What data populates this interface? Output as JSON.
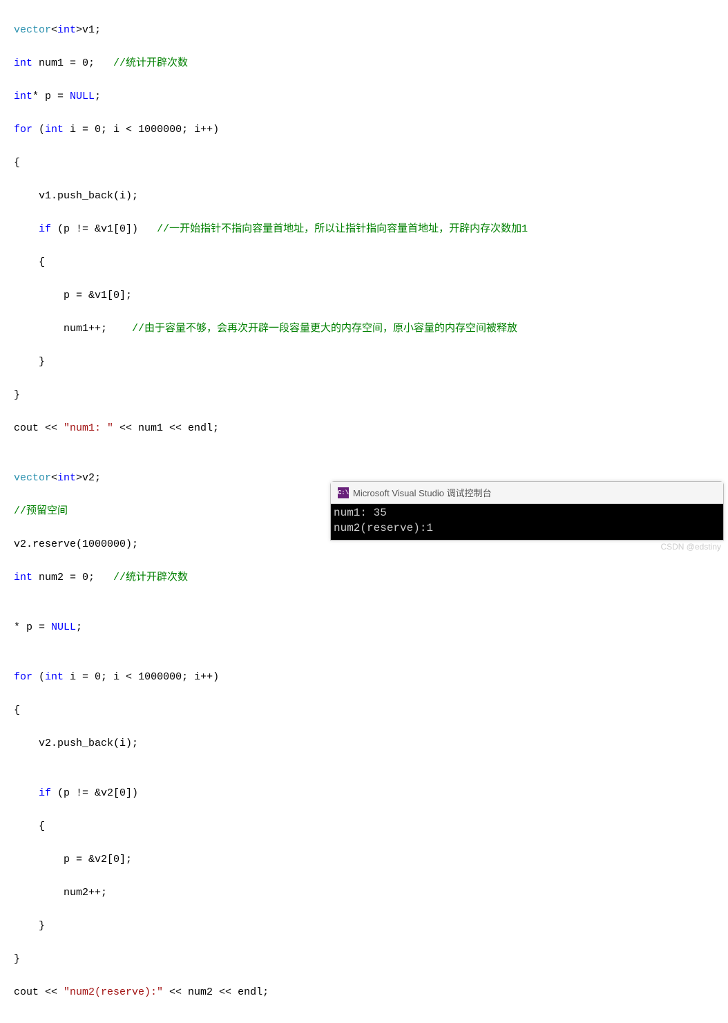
{
  "code": {
    "l1a": "vector",
    "l1b": "<",
    "l1c": "int",
    "l1d": ">v1;",
    "l2a": "int",
    "l2b": " num1 = 0;   ",
    "l2c": "//统计开辟次数",
    "l3a": "int",
    "l3b": "* p = ",
    "l3c": "NULL",
    "l3d": ";",
    "l4a": "for",
    "l4b": " (",
    "l4c": "int",
    "l4d": " i = 0; i < 1000000; i++)",
    "l5": "{",
    "l6": "    v1.push_back(i);",
    "l7a": "    ",
    "l7b": "if",
    "l7c": " (p != &v1[0])   ",
    "l7d": "//一开始指针不指向容量首地址，所以让指针指向容量首地址，开辟内存次数加1",
    "l8": "    {",
    "l9": "        p = &v1[0];",
    "l10a": "        num1++;    ",
    "l10b": "//由于容量不够，会再次开辟一段容量更大的内存空间，原小容量的内存空间被释放",
    "l11": "    }",
    "l12": "}",
    "l13a": "cout << ",
    "l13b": "\"num1: \"",
    "l13c": " << num1 << endl;",
    "l14": "",
    "l15a": "vector",
    "l15b": "<",
    "l15c": "int",
    "l15d": ">v2;",
    "l16": "//预留空间",
    "l17": "v2.reserve(1000000);",
    "l18a": "int",
    "l18b": " num2 = 0;   ",
    "l18c": "//统计开辟次数",
    "l19": "",
    "l20a": "* p = ",
    "l20b": "NULL",
    "l20c": ";",
    "l21": "",
    "l22a": "for",
    "l22b": " (",
    "l22c": "int",
    "l22d": " i = 0; i < 1000000; i++)",
    "l23": "{",
    "l24": "    v2.push_back(i);",
    "l25": "",
    "l26a": "    ",
    "l26b": "if",
    "l26c": " (p != &v2[0])",
    "l27": "    {",
    "l28": "        p = &v2[0];",
    "l29": "        num2++;",
    "l30": "    }",
    "l31": "}",
    "l32a": "cout << ",
    "l32b": "\"num2(reserve):\"",
    "l32c": " << num2 << endl;"
  },
  "console": {
    "icon": "C:\\",
    "title": "Microsoft Visual Studio 调试控制台",
    "line1": "num1: 35",
    "line2": "num2(reserve):1"
  },
  "watermark": "CSDN @edstiny"
}
